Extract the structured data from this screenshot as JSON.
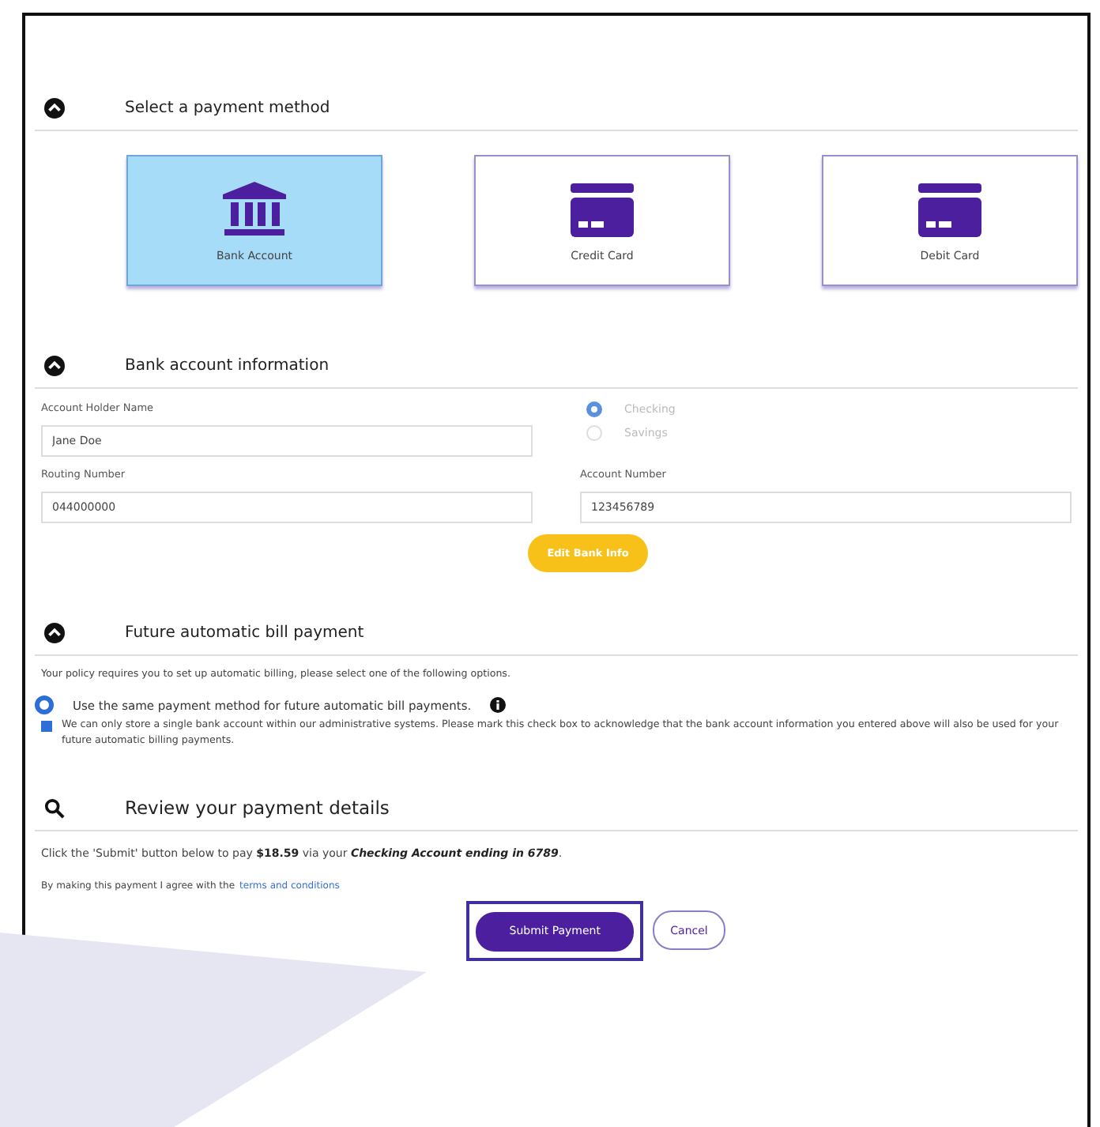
{
  "payment_method": {
    "title": "Select a payment method",
    "options": [
      {
        "kind": "bank",
        "label": "Bank Account",
        "selected": true
      },
      {
        "kind": "card",
        "label": "Credit Card",
        "selected": false
      },
      {
        "kind": "card",
        "label": "Debit Card",
        "selected": false
      }
    ]
  },
  "bank_info": {
    "title": "Bank account information",
    "holder": {
      "label": "Account Holder Name",
      "value": "Jane Doe"
    },
    "account_types": [
      {
        "label": "Checking",
        "selected": true
      },
      {
        "label": "Savings",
        "selected": false
      }
    ],
    "routing": {
      "label": "Routing Number",
      "value": "044000000"
    },
    "account": {
      "label": "Account Number",
      "value": "123456789"
    },
    "edit_button": "Edit Bank Info"
  },
  "autopay": {
    "title": "Future automatic bill payment",
    "note": "Your policy requires you to set up automatic billing, please select one of the following options.",
    "option": {
      "label": "Use the same payment method for future automatic bill payments.",
      "selected": true
    },
    "acknowledge": {
      "label": "We can only store a single bank account within our administrative systems. Please mark this check box to acknowledge that the bank account information you entered above will also be used for your future automatic billing payments.",
      "checked": true
    }
  },
  "review": {
    "title": "Review your payment details",
    "summary": "Click the 'Submit' button below to pay **$18.59** via your *Checking Account ending in 6789*.",
    "terms_prefix": "By making this payment I agree with the",
    "terms_link": "terms and conditions",
    "submit": "Submit Payment",
    "cancel": "Cancel"
  }
}
